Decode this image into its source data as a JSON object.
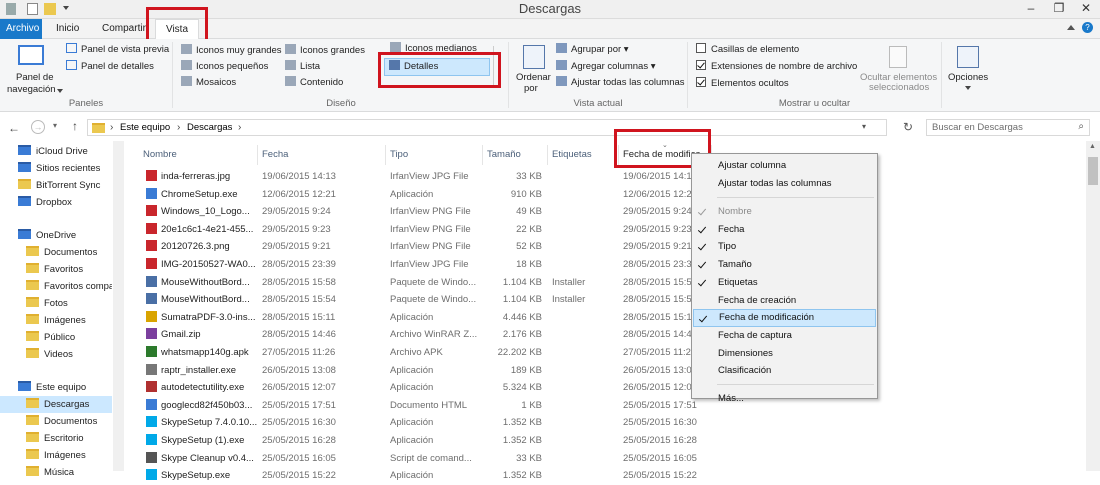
{
  "window": {
    "title": "Descargas"
  },
  "tabs": [
    "Archivo",
    "Inicio",
    "Compartir",
    "Vista"
  ],
  "ribbon": {
    "panels": {
      "panel_navegacion": [
        "Panel de",
        "navegación"
      ],
      "vista_previa": "Panel de vista previa",
      "detalles": "Panel de detalles",
      "label": "Paneles"
    },
    "diseno": {
      "items": [
        "Iconos muy grandes",
        "Iconos grandes",
        "Iconos medianos",
        "Iconos pequeños",
        "Lista",
        "Detalles",
        "Mosaicos",
        "Contenido"
      ],
      "label": "Diseño"
    },
    "vista_actual": {
      "ordenar": [
        "Ordenar",
        "por"
      ],
      "agrupar": "Agrupar por",
      "agregar": "Agregar columnas",
      "ajustar": "Ajustar todas las columnas",
      "label": "Vista actual"
    },
    "mostrar": {
      "casillas": "Casillas de elemento",
      "extensiones": "Extensiones de nombre de archivo",
      "ocultos": "Elementos ocultos",
      "ocultar_sel": [
        "Ocultar elementos",
        "seleccionados"
      ],
      "opciones": "Opciones",
      "label": "Mostrar u ocultar",
      "checks": [
        false,
        true,
        true
      ]
    }
  },
  "address": {
    "path": [
      "Este equipo",
      "Descargas"
    ],
    "search_placeholder": "Buscar en Descargas"
  },
  "nav": [
    {
      "label": "iCloud Drive",
      "icon": "cloud-icon"
    },
    {
      "label": "Sitios recientes",
      "icon": "recent-icon"
    },
    {
      "label": "BitTorrent Sync",
      "icon": "folder-icon"
    },
    {
      "label": "Dropbox",
      "icon": "dropbox-icon"
    },
    {
      "label": "OneDrive",
      "icon": "onedrive-icon"
    },
    {
      "label": "Documentos",
      "icon": "folder-icon"
    },
    {
      "label": "Favoritos",
      "icon": "folder-icon"
    },
    {
      "label": "Favoritos compa",
      "icon": "folder-icon"
    },
    {
      "label": "Fotos",
      "icon": "folder-icon"
    },
    {
      "label": "Imágenes",
      "icon": "folder-icon"
    },
    {
      "label": "Público",
      "icon": "folder-icon"
    },
    {
      "label": "Videos",
      "icon": "folder-icon"
    },
    {
      "label": "Este equipo",
      "icon": "computer-icon"
    },
    {
      "label": "Descargas",
      "icon": "folder-icon"
    },
    {
      "label": "Documentos",
      "icon": "folder-icon"
    },
    {
      "label": "Escritorio",
      "icon": "folder-icon"
    },
    {
      "label": "Imágenes",
      "icon": "folder-icon"
    },
    {
      "label": "Música",
      "icon": "folder-icon"
    }
  ],
  "columns": [
    "Nombre",
    "Fecha",
    "Tipo",
    "Tamaño",
    "Etiquetas",
    "Fecha de modifica"
  ],
  "files": [
    [
      "inda-ferreras.jpg",
      "19/06/2015 14:13",
      "IrfanView JPG File",
      "33 KB",
      "",
      "19/06/2015 14:13",
      "#c9262c"
    ],
    [
      "ChromeSetup.exe",
      "12/06/2015 12:21",
      "Aplicación",
      "910 KB",
      "",
      "12/06/2015 12:21",
      "#3a7bd5"
    ],
    [
      "Windows_10_Logo...",
      "29/05/2015 9:24",
      "IrfanView PNG File",
      "49 KB",
      "",
      "29/05/2015 9:24",
      "#c9262c"
    ],
    [
      "20e1c6c1-4e21-455...",
      "29/05/2015 9:23",
      "IrfanView PNG File",
      "22 KB",
      "",
      "29/05/2015 9:23",
      "#c9262c"
    ],
    [
      "20120726.3.png",
      "29/05/2015 9:21",
      "IrfanView PNG File",
      "52 KB",
      "",
      "29/05/2015 9:21",
      "#c9262c"
    ],
    [
      "IMG-20150527-WA0...",
      "28/05/2015 23:39",
      "IrfanView JPG File",
      "18 KB",
      "",
      "28/05/2015 23:39",
      "#c9262c"
    ],
    [
      "MouseWithoutBord...",
      "28/05/2015 15:58",
      "Paquete de Windo...",
      "1.104 KB",
      "Installer",
      "28/05/2015 15:58",
      "#4a6fa5"
    ],
    [
      "MouseWithoutBord...",
      "28/05/2015 15:54",
      "Paquete de Windo...",
      "1.104 KB",
      "Installer",
      "28/05/2015 15:54",
      "#4a6fa5"
    ],
    [
      "SumatraPDF-3.0-ins...",
      "28/05/2015 15:11",
      "Aplicación",
      "4.446 KB",
      "",
      "28/05/2015 15:11",
      "#d9a400"
    ],
    [
      "Gmail.zip",
      "28/05/2015 14:46",
      "Archivo WinRAR Z...",
      "2.176 KB",
      "",
      "28/05/2015 14:46",
      "#7b3f9e"
    ],
    [
      "whatsmapp140g.apk",
      "27/05/2015 11:26",
      "Archivo APK",
      "22.202 KB",
      "",
      "27/05/2015 11:26",
      "#2c7a2c"
    ],
    [
      "raptr_installer.exe",
      "26/05/2015 13:08",
      "Aplicación",
      "189 KB",
      "",
      "26/05/2015 13:08",
      "#777777"
    ],
    [
      "autodetectutility.exe",
      "26/05/2015 12:07",
      "Aplicación",
      "5.324 KB",
      "",
      "26/05/2015 12:07",
      "#b03030"
    ],
    [
      "googlecd82f450b03...",
      "25/05/2015 17:51",
      "Documento HTML",
      "1 KB",
      "",
      "25/05/2015 17:51",
      "#3a7bd5"
    ],
    [
      "SkypeSetup 7.4.0.10...",
      "25/05/2015 16:30",
      "Aplicación",
      "1.352 KB",
      "",
      "25/05/2015 16:30",
      "#00a9e8"
    ],
    [
      "SkypeSetup (1).exe",
      "25/05/2015 16:28",
      "Aplicación",
      "1.352 KB",
      "",
      "25/05/2015 16:28",
      "#00a9e8"
    ],
    [
      "Skype Cleanup v0.4...",
      "25/05/2015 16:05",
      "Script de comand...",
      "33 KB",
      "",
      "25/05/2015 16:05",
      "#555555"
    ],
    [
      "SkypeSetup.exe",
      "25/05/2015 15:22",
      "Aplicación",
      "1.352 KB",
      "",
      "25/05/2015 15:22",
      "#00a9e8"
    ]
  ],
  "menu": {
    "top": [
      "Ajustar columna",
      "Ajustar todas las columnas"
    ],
    "items": [
      {
        "label": "Nombre",
        "checked": true,
        "disabled": true
      },
      {
        "label": "Fecha",
        "checked": true
      },
      {
        "label": "Tipo",
        "checked": true
      },
      {
        "label": "Tamaño",
        "checked": true
      },
      {
        "label": "Etiquetas",
        "checked": true
      },
      {
        "label": "Fecha de creación",
        "checked": false
      },
      {
        "label": "Fecha de modificación",
        "checked": true,
        "highlighted": true
      },
      {
        "label": "Fecha de captura",
        "checked": false
      },
      {
        "label": "Dimensiones",
        "checked": false
      },
      {
        "label": "Clasificación",
        "checked": false
      }
    ],
    "more": "Más..."
  },
  "colors": {
    "accent": "#1979ca",
    "highlight_box": "#d0141e",
    "selection": "#cde8fd"
  }
}
